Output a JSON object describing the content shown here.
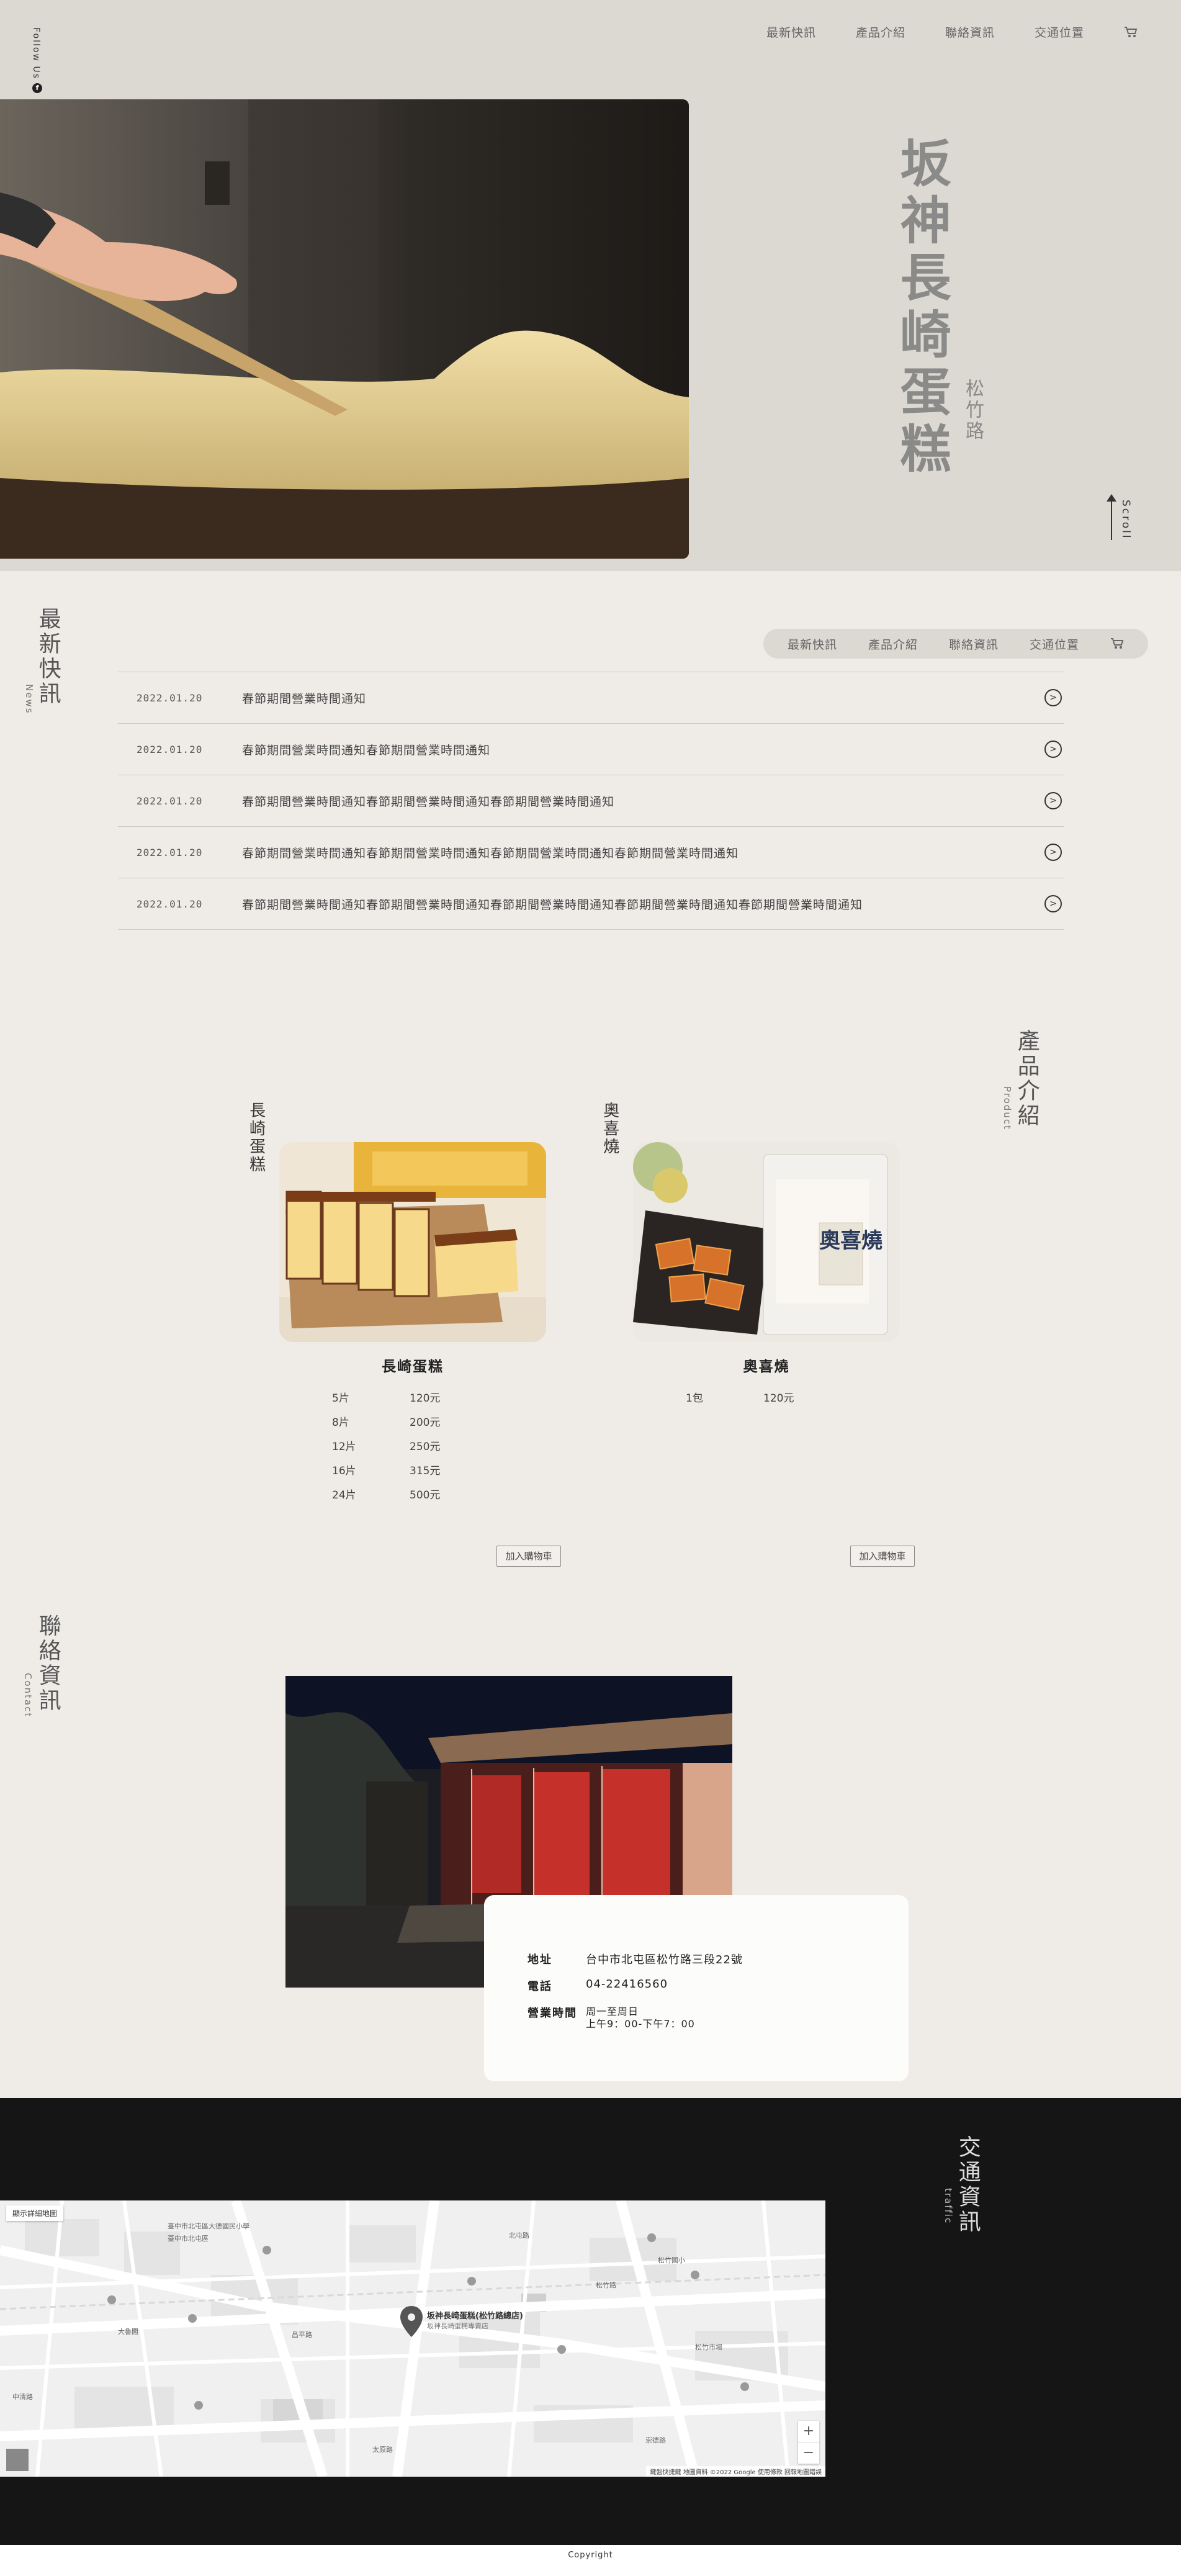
{
  "nav": {
    "items": [
      "最新快訊",
      "產品介紹",
      "聯絡資訊",
      "交通位置"
    ],
    "cart_icon": "cart-icon"
  },
  "hero": {
    "follow": "Follow Us",
    "title": "坂神長崎蛋糕",
    "subtitle": "松竹路",
    "scroll": "Scroll"
  },
  "news": {
    "title": "最新快訊",
    "subtitle": "News",
    "items": [
      {
        "date": "2022.01.20",
        "text": "春節期間營業時間通知"
      },
      {
        "date": "2022.01.20",
        "text": "春節期間營業時間通知春節期間營業時間通知"
      },
      {
        "date": "2022.01.20",
        "text": "春節期間營業時間通知春節期間營業時間通知春節期間營業時間通知"
      },
      {
        "date": "2022.01.20",
        "text": "春節期間營業時間通知春節期間營業時間通知春節期間營業時間通知春節期間營業時間通知"
      },
      {
        "date": "2022.01.20",
        "text": "春節期間營業時間通知春節期間營業時間通知春節期間營業時間通知春節期間營業時間通知春節期間營業時間通知"
      }
    ]
  },
  "products": {
    "title": "產品介紹",
    "subtitle": "Product",
    "items": [
      {
        "label": "長崎蛋糕",
        "name": "長崎蛋糕",
        "prices": [
          {
            "qty": "5片",
            "price": "120元"
          },
          {
            "qty": "8片",
            "price": "200元"
          },
          {
            "qty": "12片",
            "price": "250元"
          },
          {
            "qty": "16片",
            "price": "315元"
          },
          {
            "qty": "24片",
            "price": "500元"
          }
        ],
        "button": "加入購物車"
      },
      {
        "label": "奧喜燒",
        "name": "奧喜燒",
        "package_text": "奧喜燒",
        "prices": [
          {
            "qty": "1包",
            "price": "120元"
          }
        ],
        "button": "加入購物車"
      }
    ]
  },
  "contact": {
    "title": "聯絡資訊",
    "subtitle": "Contact",
    "address_label": "地址",
    "address": "台中市北屯區松竹路三段22號",
    "phone_label": "電話",
    "phone": "04-22416560",
    "hours_label": "營業時間",
    "hours_line1": "周一至周日",
    "hours_line2": "上午9：00-下午7：00"
  },
  "traffic": {
    "title": "交通資訊",
    "subtitle": "traffic",
    "map_button": "顯示詳細地圖",
    "map_pin_label": "坂神長崎蛋糕(松竹路總店)",
    "map_pin_sub": "坂神長崎蛋糕專賣店",
    "map_labels": [
      "臺中市北屯區",
      "大魯閣",
      "松竹路",
      "松竹市場",
      "昌平路",
      "中清路",
      "太原路",
      "崇德路",
      "臺中市北屯區大德國民小學",
      "北屯路",
      "松竹國小"
    ],
    "attribution": "鍵盤快捷鍵  地圖資料 ©2022 Google  使用條款  回報地圖錯誤",
    "zoom_in": "+",
    "zoom_out": "−"
  },
  "footer": {
    "text": "Copyright"
  }
}
